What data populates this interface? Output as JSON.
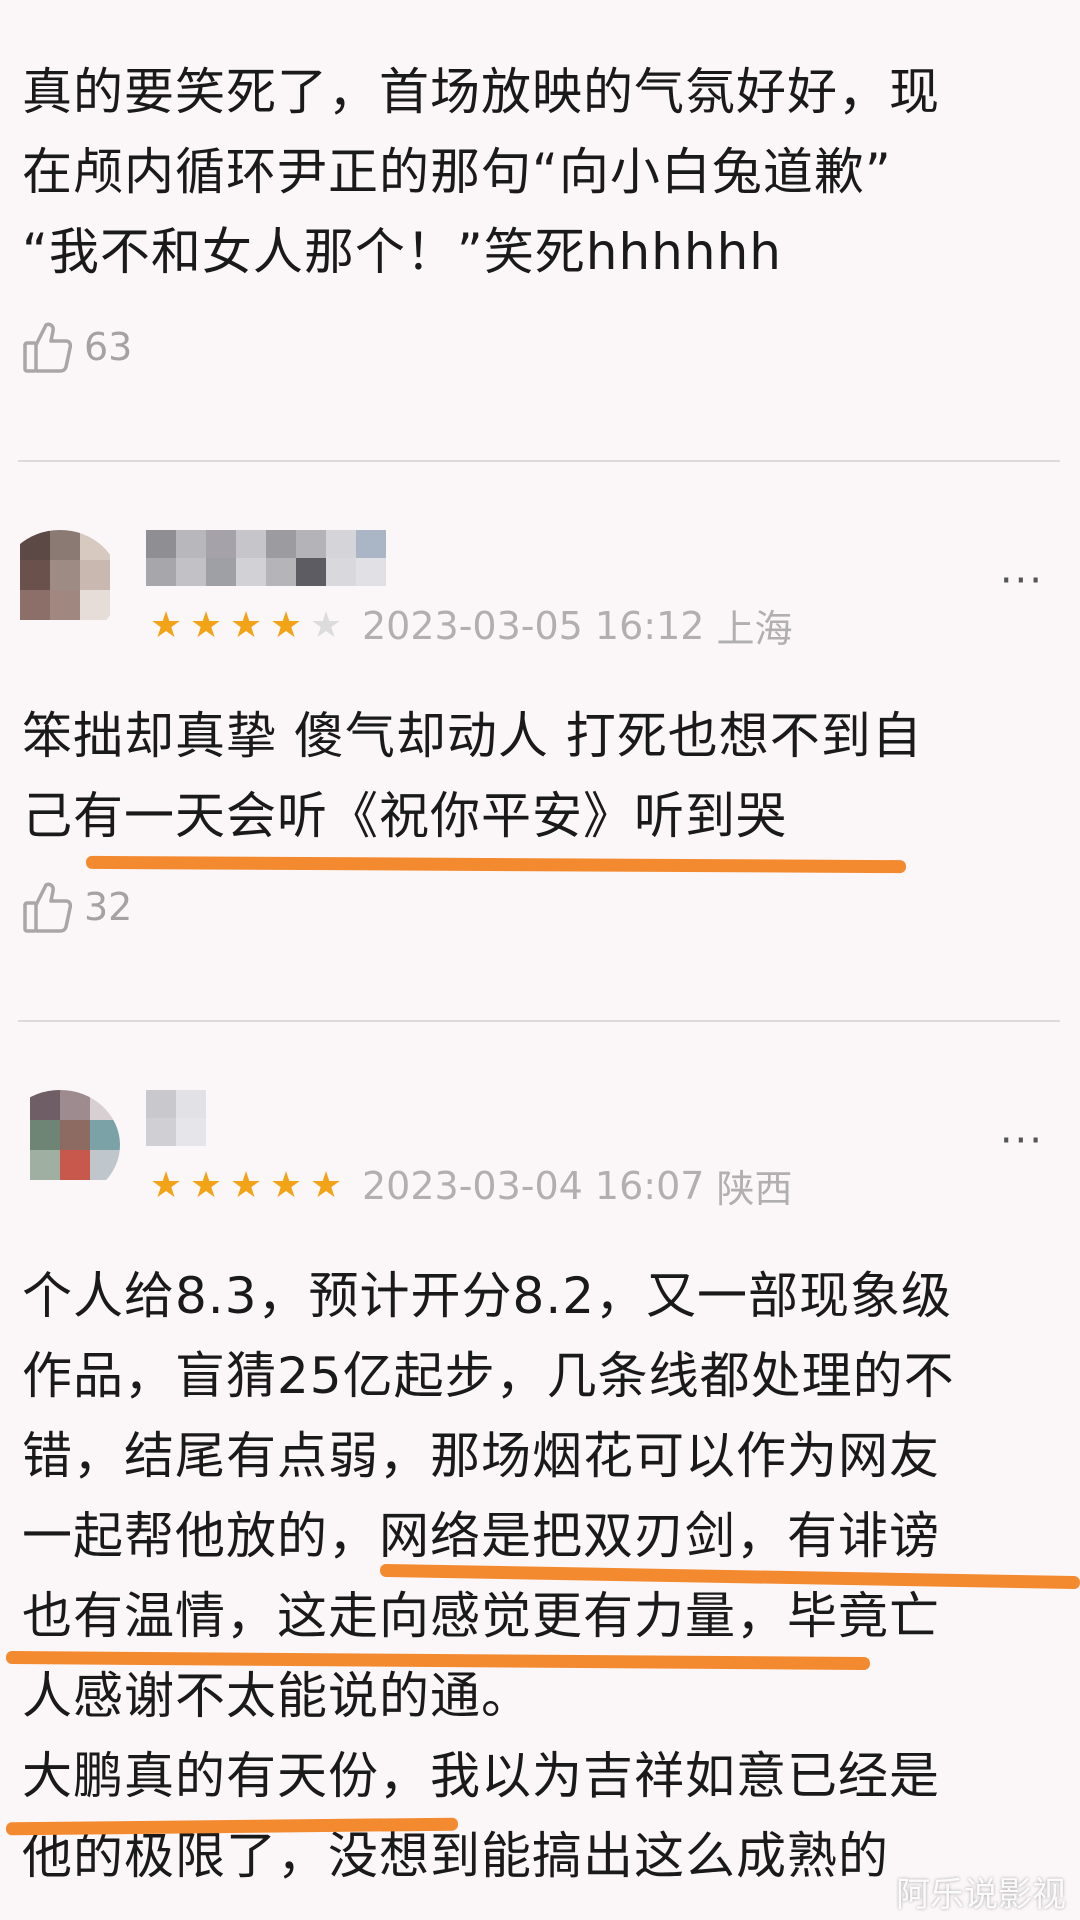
{
  "comment1": {
    "lines": [
      "真的要笑死了，首场放映的气氛好好，现",
      "在颅内循环尹正的那句“向小白兔道歉”",
      "“我不和女人那个！”笑死hhhhhh"
    ],
    "likes": "63"
  },
  "comment2": {
    "stars_on": 4,
    "date": "2023-03-05 16:12",
    "location": "上海",
    "lines": [
      "笨拙却真挚 傻气却动人 打死也想不到自",
      "己有一天会听《祝你平安》听到哭"
    ],
    "likes": "32",
    "more": "···"
  },
  "comment3": {
    "stars_on": 5,
    "date": "2023-03-04 16:07",
    "location": "陕西",
    "lines": [
      "个人给8.3，预计开分8.2，又一部现象级",
      "作品，盲猜25亿起步，几条线都处理的不",
      "错，结尾有点弱，那场烟花可以作为网友",
      "一起帮他放的，网络是把双刃剑，有诽谤",
      "也有温情，这走向感觉更有力量，毕竟亡",
      "人感谢不太能说的通。",
      "大鹏真的有天份，我以为吉祥如意已经是",
      "他的极限了，没想到能搞出这么成熟的"
    ],
    "more": "···"
  },
  "watermark": "阿乐说影视",
  "colors": {
    "star": "#f3a318",
    "highlight": "#f38a30",
    "background": "#fbf7f8"
  }
}
